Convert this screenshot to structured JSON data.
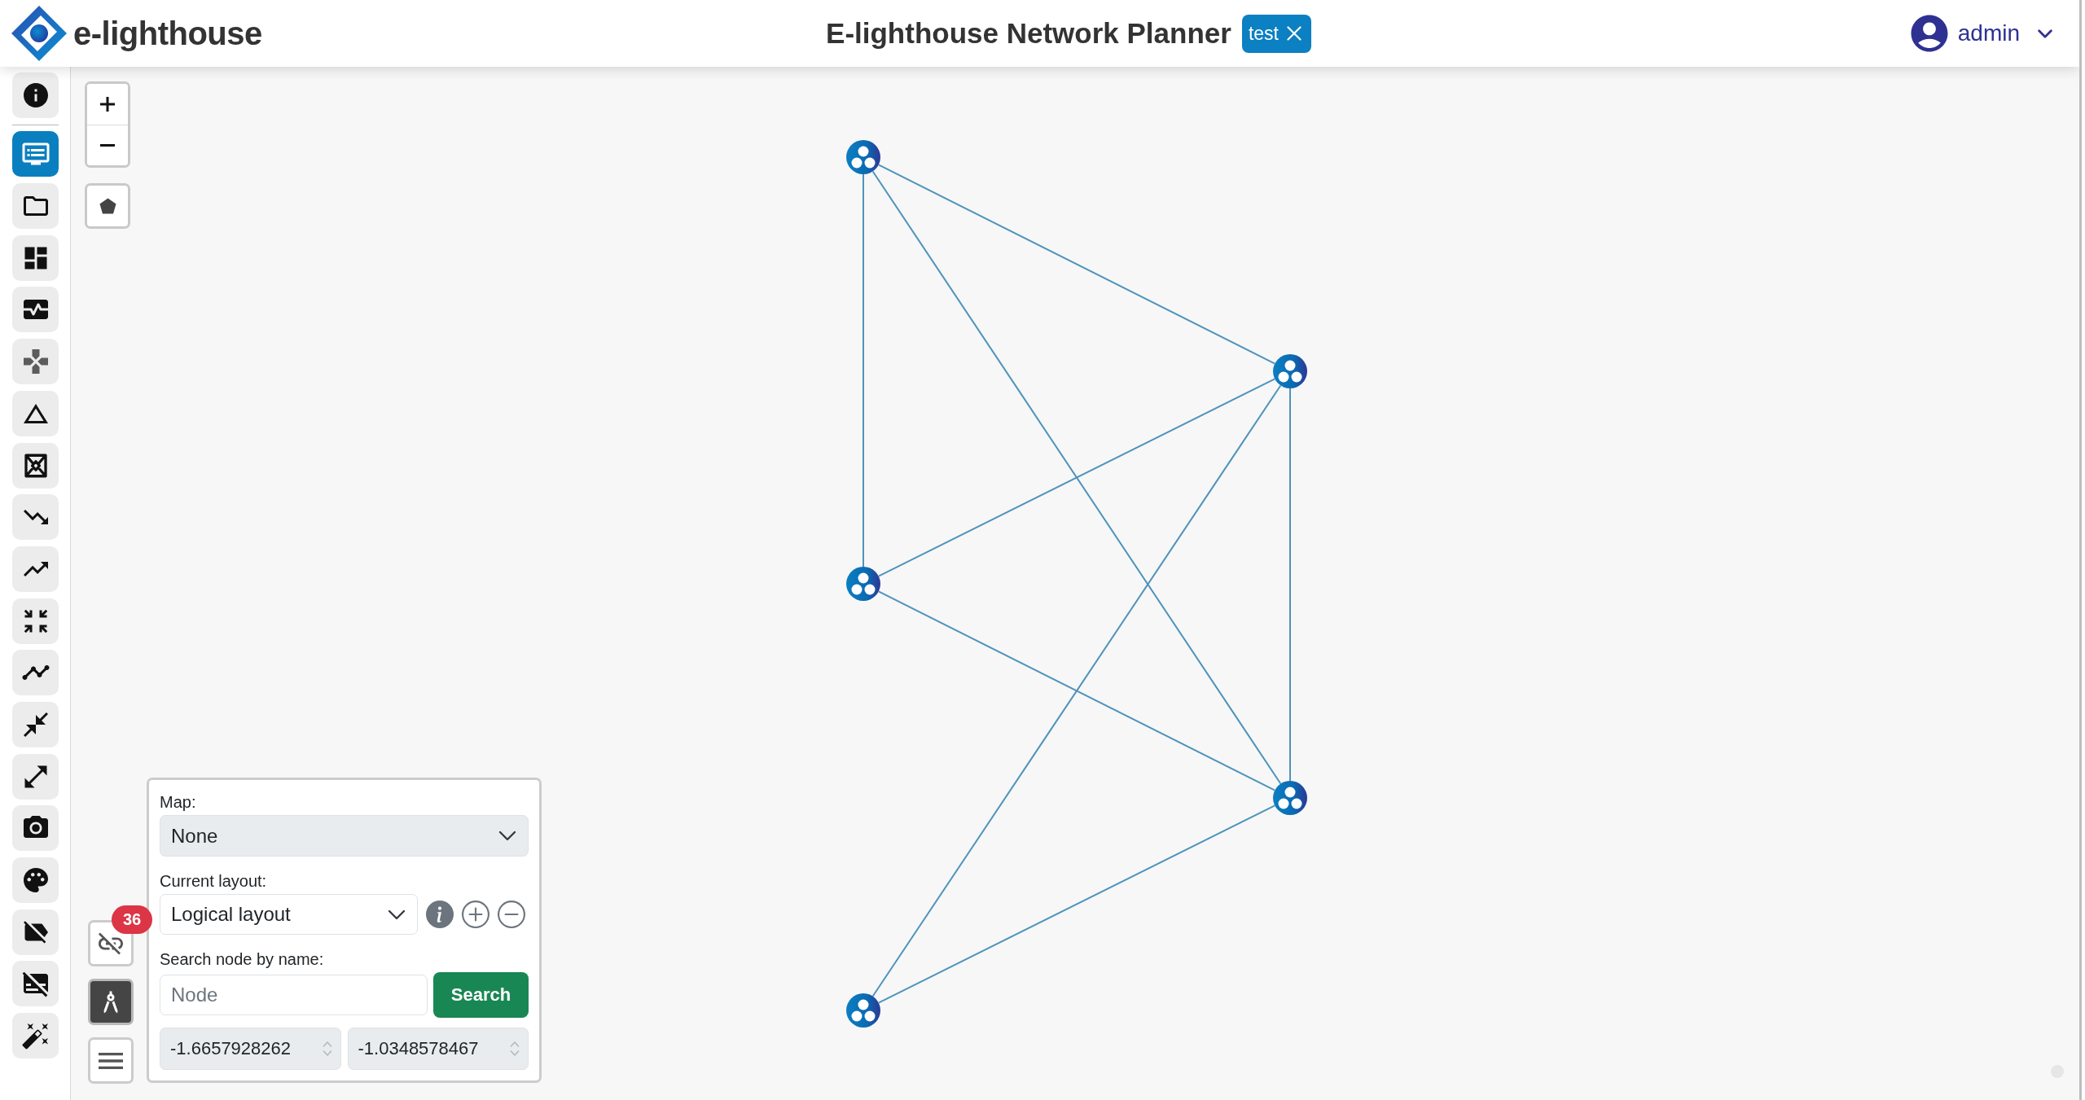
{
  "header": {
    "brand": "e-lighthouse",
    "title": "E-lighthouse Network Planner",
    "project_tag": {
      "label": "test"
    },
    "user": {
      "name": "admin"
    }
  },
  "sidebar": {
    "items": [
      {
        "kind": "info",
        "selected": false,
        "disabled": false
      },
      {
        "kind": "display",
        "selected": true,
        "disabled": false
      },
      {
        "kind": "folder",
        "selected": false,
        "disabled": false
      },
      {
        "kind": "dashboard",
        "selected": false,
        "disabled": false
      },
      {
        "kind": "pulse",
        "selected": false,
        "disabled": false
      },
      {
        "kind": "gamepad",
        "selected": false,
        "disabled": true
      },
      {
        "kind": "triangle",
        "selected": false,
        "disabled": false
      },
      {
        "kind": "hourglass",
        "selected": false,
        "disabled": false
      },
      {
        "kind": "decline",
        "selected": false,
        "disabled": false
      },
      {
        "kind": "growth",
        "selected": false,
        "disabled": false
      },
      {
        "kind": "compress",
        "selected": false,
        "disabled": false
      },
      {
        "kind": "timeline",
        "selected": false,
        "disabled": false
      },
      {
        "kind": "collapse",
        "selected": false,
        "disabled": false
      },
      {
        "kind": "expand",
        "selected": false,
        "disabled": false
      },
      {
        "kind": "camera",
        "selected": false,
        "disabled": false
      },
      {
        "kind": "palette",
        "selected": false,
        "disabled": false
      },
      {
        "kind": "unlabel",
        "selected": false,
        "disabled": false
      },
      {
        "kind": "unsubtitle",
        "selected": false,
        "disabled": false
      },
      {
        "kind": "wand",
        "selected": false,
        "disabled": false
      }
    ]
  },
  "tool_buttons": [
    {
      "kind": "unlink",
      "active": false,
      "badge": "36"
    },
    {
      "kind": "compass",
      "active": true
    },
    {
      "kind": "menu",
      "active": false
    }
  ],
  "layout_panel": {
    "map": {
      "label": "Map:",
      "value": "None",
      "disabled": true
    },
    "layout": {
      "label": "Current layout:",
      "value": "Logical layout",
      "disabled": false
    },
    "search": {
      "label": "Search node by name:",
      "placeholder": "Node",
      "button": "Search"
    },
    "coordinates": [
      {
        "value": "-1.6657928262",
        "disabled": true
      },
      {
        "value": "-1.0348578467",
        "disabled": true
      }
    ]
  }
}
